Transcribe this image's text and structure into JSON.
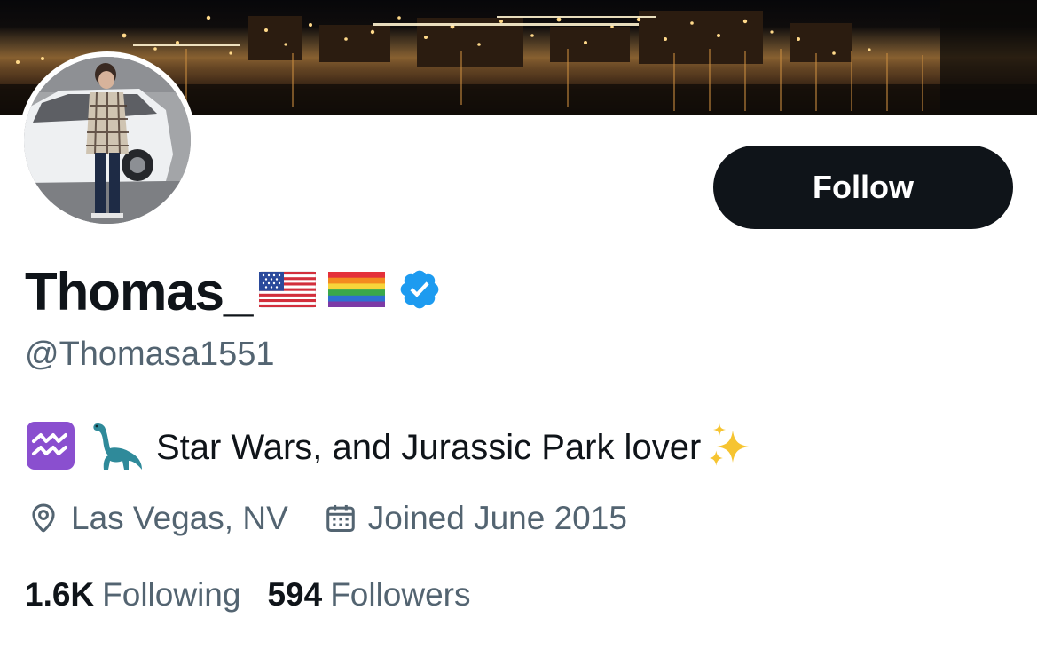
{
  "profile": {
    "display_name": "Thomas_",
    "handle": "@Thomasa1551",
    "name_badges": [
      "us-flag-icon",
      "rainbow-flag-icon",
      "verified-badge-icon"
    ],
    "bio": {
      "emoji_prefix": [
        "aquarius-icon",
        "sauropod-icon"
      ],
      "text": "Star Wars, and Jurassic Park lover",
      "emoji_suffix": "sparkles-icon"
    },
    "location": "Las Vegas, NV",
    "joined": "Joined June 2015",
    "following_count": "1.6K",
    "following_label": "Following",
    "followers_count": "594",
    "followers_label": "Followers"
  },
  "actions": {
    "follow_label": "Follow"
  },
  "colors": {
    "text_primary": "#0f1419",
    "text_secondary": "#536471",
    "button_bg": "#0f1419",
    "verified_blue": "#1d9bf0"
  }
}
